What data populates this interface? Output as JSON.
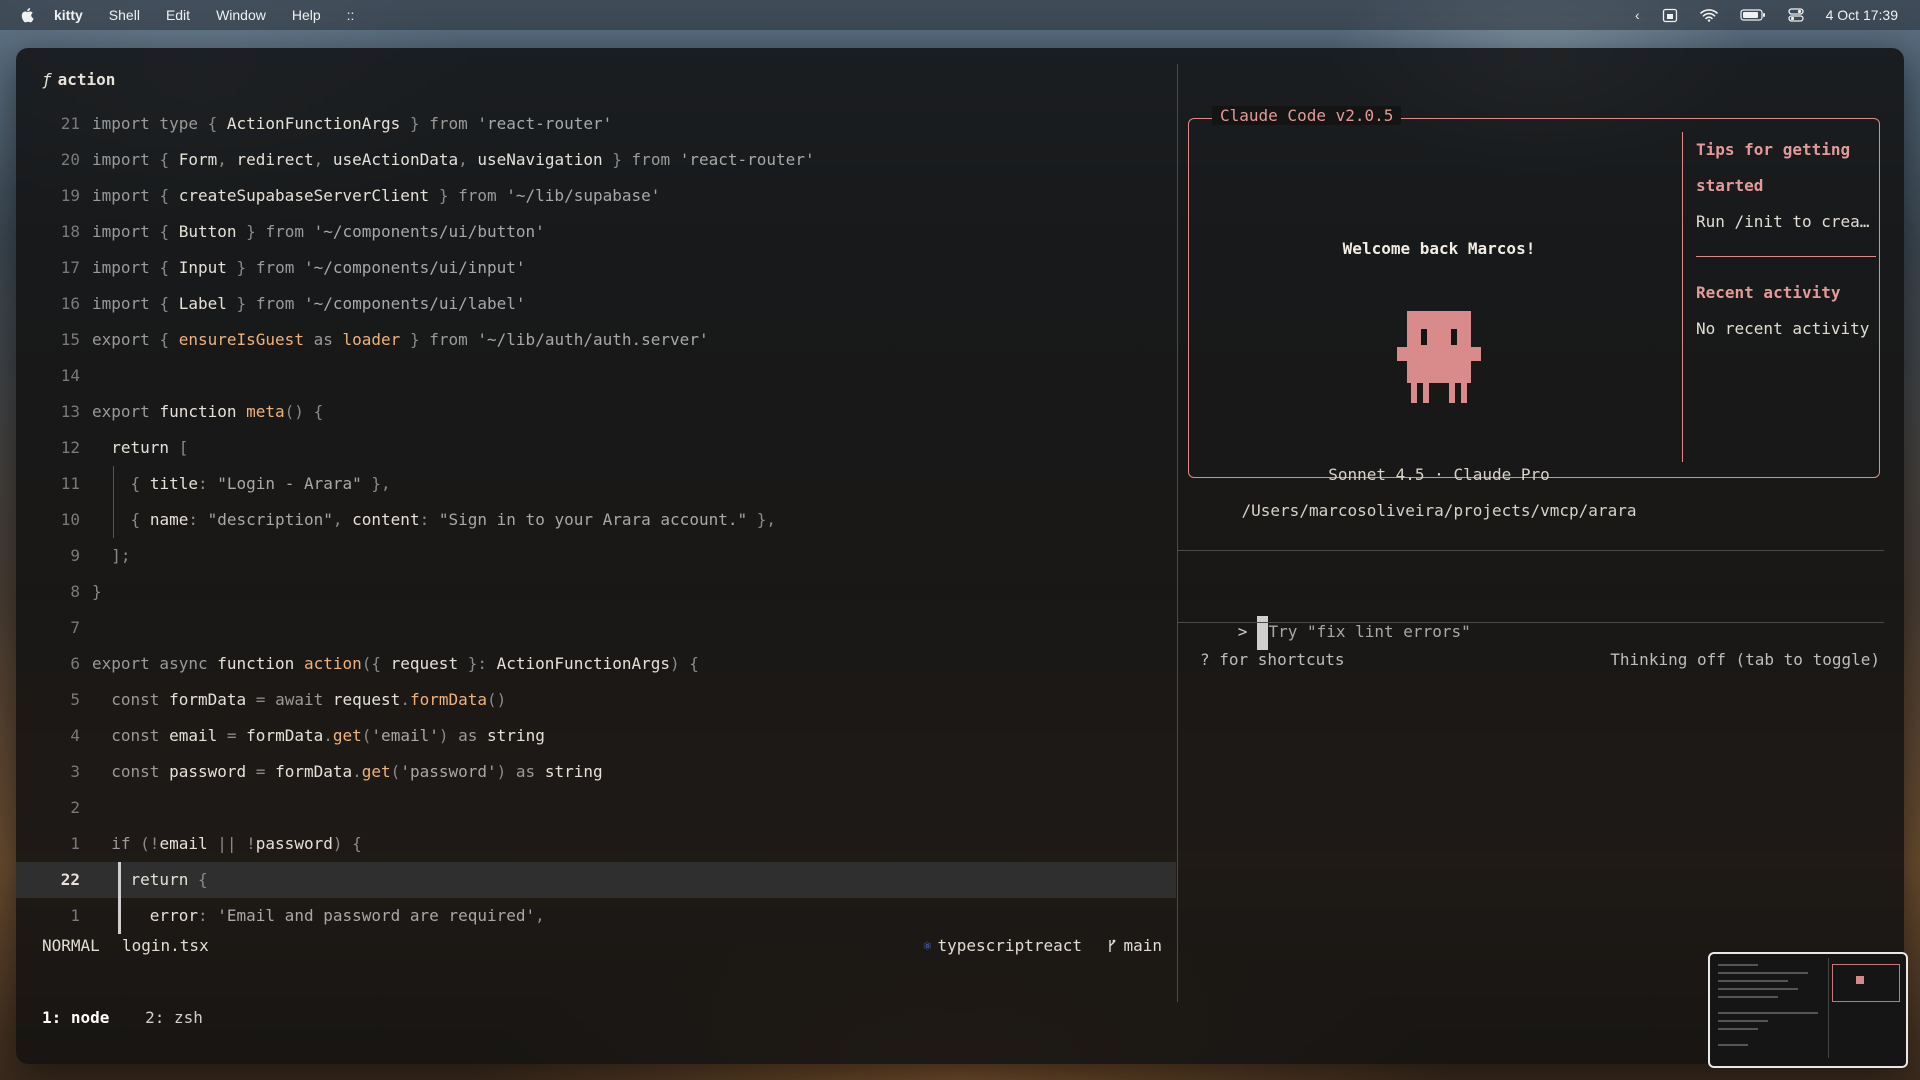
{
  "menubar": {
    "app_name": "kitty",
    "items": [
      "Shell",
      "Edit",
      "Window",
      "Help",
      "::"
    ],
    "datetime": "4 Oct  17:39"
  },
  "editor": {
    "function_label": "action",
    "lines": [
      {
        "n": "21",
        "html": "<span class='kw'>import type</span> <span class='pn'>{</span> <span class='id'>ActionFunctionArgs</span> <span class='pn'>}</span> <span class='kw'>from</span> <span class='str'>'react-router'</span>"
      },
      {
        "n": "20",
        "html": "<span class='kw'>import</span> <span class='pn'>{</span> <span class='id'>Form</span><span class='pn'>,</span> <span class='id'>redirect</span><span class='pn'>,</span> <span class='id'>useActionData</span><span class='pn'>,</span> <span class='id'>useNavigation</span> <span class='pn'>}</span> <span class='kw'>from</span> <span class='str'>'react-router'</span>"
      },
      {
        "n": "19",
        "html": "<span class='kw'>import</span> <span class='pn'>{</span> <span class='id'>createSupabaseServerClient</span> <span class='pn'>}</span> <span class='kw'>from</span> <span class='str'>'~/lib/supabase'</span>"
      },
      {
        "n": "18",
        "html": "<span class='kw'>import</span> <span class='pn'>{</span> <span class='id'>Button</span> <span class='pn'>}</span> <span class='kw'>from</span> <span class='str'>'~/components/ui/button'</span>"
      },
      {
        "n": "17",
        "html": "<span class='kw'>import</span> <span class='pn'>{</span> <span class='id'>Input</span> <span class='pn'>}</span> <span class='kw'>from</span> <span class='str'>'~/components/ui/input'</span>"
      },
      {
        "n": "16",
        "html": "<span class='kw'>import</span> <span class='pn'>{</span> <span class='id'>Label</span> <span class='pn'>}</span> <span class='kw'>from</span> <span class='str'>'~/components/ui/label'</span>"
      },
      {
        "n": "15",
        "html": "<span class='kw'>export</span> <span class='pn'>{</span> <span class='fn'>ensureIsGuest</span> <span class='kw'>as</span> <span class='fn'>loader</span> <span class='pn'>}</span> <span class='kw'>from</span> <span class='str'>'~/lib/auth/auth.server'</span>"
      },
      {
        "n": "14",
        "html": ""
      },
      {
        "n": "13",
        "html": "<span class='kw'>export</span> <span class='id'>function</span> <span class='fn'>meta</span><span class='pn'>() {</span>"
      },
      {
        "n": "12",
        "html": "  <span class='id'>return</span> <span class='pn'>[</span>"
      },
      {
        "n": "11",
        "html": "    <span class='pn'>{</span> <span class='id'>title</span><span class='pn'>:</span> <span class='str'>\"Login - Arara\"</span> <span class='pn'>},</span>"
      },
      {
        "n": "10",
        "html": "    <span class='pn'>{</span> <span class='id'>name</span><span class='pn'>:</span> <span class='str'>\"description\"</span><span class='pn'>,</span> <span class='id'>content</span><span class='pn'>:</span> <span class='str'>\"Sign in to your Arara account.\"</span> <span class='pn'>},</span>"
      },
      {
        "n": "9",
        "html": "  <span class='pn'>];</span>"
      },
      {
        "n": "8",
        "html": "<span class='pn'>}</span>"
      },
      {
        "n": "7",
        "html": ""
      },
      {
        "n": "6",
        "html": "<span class='kw'>export async</span> <span class='id'>function</span> <span class='fn'>action</span><span class='pn'>({</span> <span class='id'>request</span> <span class='pn'>}:</span> <span class='id'>ActionFunctionArgs</span><span class='pn'>) {</span>"
      },
      {
        "n": "5",
        "html": "  <span class='kw'>const</span> <span class='id'>formData</span> <span class='pn'>=</span> <span class='kw'>await</span> <span class='id'>request</span><span class='pn'>.</span><span class='fn'>formData</span><span class='pn'>()</span>"
      },
      {
        "n": "4",
        "html": "  <span class='kw'>const</span> <span class='id'>email</span> <span class='pn'>=</span> <span class='id'>formData</span><span class='pn'>.</span><span class='fn'>get</span><span class='pn'>(</span><span class='str'>'email'</span><span class='pn'>)</span> <span class='kw'>as</span> <span class='id'>string</span>"
      },
      {
        "n": "3",
        "html": "  <span class='kw'>const</span> <span class='id'>password</span> <span class='pn'>=</span> <span class='id'>formData</span><span class='pn'>.</span><span class='fn'>get</span><span class='pn'>(</span><span class='str'>'password'</span><span class='pn'>)</span> <span class='kw'>as</span> <span class='id'>string</span>"
      },
      {
        "n": "2",
        "html": ""
      },
      {
        "n": "1",
        "html": "  <span class='kw'>if</span> <span class='pn'>(!</span><span class='id'>email</span> <span class='pn'>|| !</span><span class='id'>password</span><span class='pn'>) {</span>"
      },
      {
        "n": "22",
        "html": "    <span class='id'>return</span> <span class='pn'>{</span>",
        "current": true
      },
      {
        "n": "1",
        "html": "      <span class='id'>error</span><span class='pn'>:</span> <span class='str'>'Email and password are required'</span><span class='pn'>,</span>"
      }
    ],
    "status": {
      "mode": "NORMAL",
      "file": "login.tsx",
      "filetype": "typescriptreact",
      "branch": "main"
    },
    "tabs": [
      "1: node",
      "2: zsh"
    ]
  },
  "claude": {
    "title": "Claude Code v2.0.5",
    "welcome": "Welcome back Marcos!",
    "model": "Sonnet 4.5 · Claude Pro",
    "path": "/Users/marcosoliveira/projects/vmcp/arara",
    "tips_heading_1": "Tips for getting",
    "tips_heading_2": "started",
    "tips_text": "Run /init to crea…",
    "recent_heading": "Recent activity",
    "recent_text": "No recent activity",
    "prompt_symbol": ">",
    "placeholder": "Try \"fix lint errors\"",
    "hint_left": "? for shortcuts",
    "hint_right": "Thinking off (tab to toggle)",
    "accent": "#e08a8a"
  }
}
